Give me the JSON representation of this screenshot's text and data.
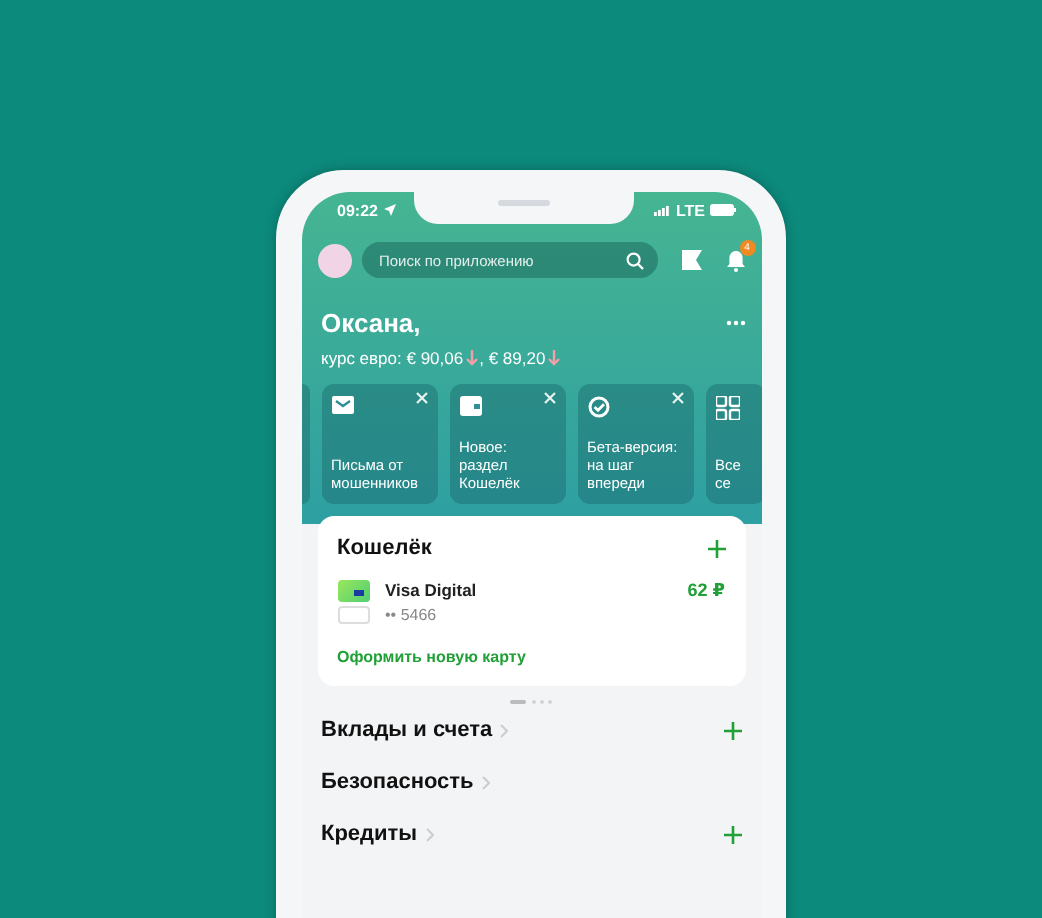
{
  "status_bar": {
    "time": "09:22",
    "network": "LTE"
  },
  "header": {
    "search": {
      "placeholder": "Поиск по приложению"
    },
    "notifications": {
      "badge": "4"
    },
    "greeting": "Оксана,",
    "rates": [
      {
        "text": "курс евро: € 90,06",
        "falling": true
      },
      {
        "text": ", € 89,20",
        "falling": true
      }
    ]
  },
  "shortcuts": [
    {
      "kind": "mail",
      "label": "Письма от мошенников",
      "closable": true
    },
    {
      "kind": "wallet",
      "label": "Новое: раздел Кошелёк",
      "closable": true
    },
    {
      "kind": "check",
      "label": "Бета-версия: на шаг впереди",
      "closable": true
    },
    {
      "kind": "grid",
      "label": "Все се",
      "closable": false
    }
  ],
  "wallet": {
    "title": "Кошелёк",
    "cards": [
      {
        "name": "Visa Digital",
        "number": "•• 5466",
        "balance": "62 ₽"
      }
    ],
    "link": "Оформить новую карту"
  },
  "sections": [
    {
      "title": "Вклады и счета",
      "addable": true
    },
    {
      "title": "Безопасность",
      "addable": false
    },
    {
      "title": "Кредиты",
      "addable": true
    }
  ]
}
